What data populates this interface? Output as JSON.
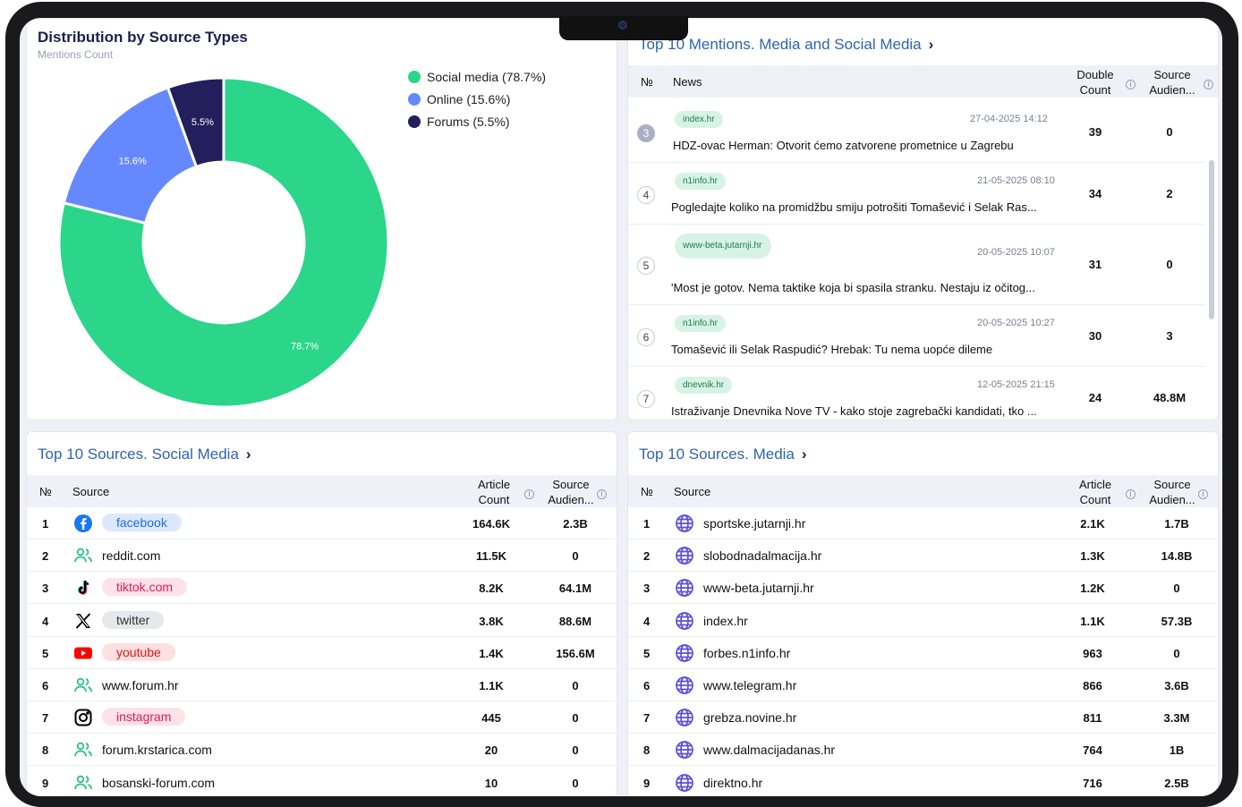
{
  "chart": {
    "title": "Distribution by Source Types",
    "subtitle": "Mentions Count",
    "legend": [
      {
        "label": "Social media (78.7%)",
        "color": "#2bd68a"
      },
      {
        "label": "Online (15.6%)",
        "color": "#6688ff"
      },
      {
        "label": "Forums (5.5%)",
        "color": "#231f5c"
      }
    ]
  },
  "chart_data": {
    "type": "pie",
    "title": "Distribution by Source Types",
    "subtitle": "Mentions Count",
    "categories": [
      "Social media",
      "Online",
      "Forums"
    ],
    "values": [
      78.7,
      15.6,
      5.5
    ],
    "labels": [
      "78.7%",
      "15.6%",
      "5.5%"
    ],
    "colors": [
      "#2bd68a",
      "#6688ff",
      "#231f5c"
    ],
    "donut": true,
    "legend": "top-right"
  },
  "mentions": {
    "title": "Top 10 Mentions. Media and Social Media",
    "headers": {
      "num": "№",
      "news": "News",
      "double_count": "Double Count",
      "audience": "Source Audien..."
    },
    "rows": [
      {
        "num": "3",
        "tag": "index.hr",
        "date": "27-04-2025 14:12",
        "text": "HDZ-ovac Herman: Otvorit ćemo zatvorene prometnice u Zagrebu",
        "count": "39",
        "audience": "0"
      },
      {
        "num": "4",
        "tag": "n1info.hr",
        "date": "21-05-2025 08:10",
        "text": "Pogledajte koliko na promidžbu smiju potrošiti Tomašević i Selak Ras...",
        "count": "34",
        "audience": "2"
      },
      {
        "num": "5",
        "tag": "www-beta.jutarnji.hr",
        "date": "20-05-2025 10:07",
        "text": "'Most je gotov. Nema taktike koja bi spasila stranku. Nestaju iz očitog...",
        "count": "31",
        "audience": "0"
      },
      {
        "num": "6",
        "tag": "n1info.hr",
        "date": "20-05-2025 10:27",
        "text": "Tomašević ili Selak Raspudić? Hrebak: Tu nema uopće dileme",
        "count": "30",
        "audience": "3"
      },
      {
        "num": "7",
        "tag": "dnevnik.hr",
        "date": "12-05-2025 21:15",
        "text": "Istraživanje Dnevnika Nove TV - kako stoje zagrebački kandidati, tko ...",
        "count": "24",
        "audience": "48.8M"
      }
    ]
  },
  "social": {
    "title": "Top 10 Sources. Social Media",
    "headers": {
      "num": "№",
      "source": "Source",
      "count": "Article Count",
      "audience": "Source Audien..."
    },
    "rows": [
      {
        "num": "1",
        "icon": "facebook-icon",
        "name": "facebook",
        "count": "164.6K",
        "audience": "2.3B"
      },
      {
        "num": "2",
        "icon": "users-icon",
        "name": "reddit.com",
        "count": "11.5K",
        "audience": "0"
      },
      {
        "num": "3",
        "icon": "tiktok-icon",
        "name": "tiktok.com",
        "count": "8.2K",
        "audience": "64.1M"
      },
      {
        "num": "4",
        "icon": "x-icon",
        "name": "twitter",
        "count": "3.8K",
        "audience": "88.6M"
      },
      {
        "num": "5",
        "icon": "youtube-icon",
        "name": "youtube",
        "count": "1.4K",
        "audience": "156.6M"
      },
      {
        "num": "6",
        "icon": "users-icon",
        "name": "www.forum.hr",
        "count": "1.1K",
        "audience": "0"
      },
      {
        "num": "7",
        "icon": "instagram-icon",
        "name": "instagram",
        "count": "445",
        "audience": "0"
      },
      {
        "num": "8",
        "icon": "users-icon",
        "name": "forum.krstarica.com",
        "count": "20",
        "audience": "0"
      },
      {
        "num": "9",
        "icon": "users-icon",
        "name": "bosanski-forum.com",
        "count": "10",
        "audience": "0"
      }
    ]
  },
  "media": {
    "title": "Top 10 Sources. Media",
    "headers": {
      "num": "№",
      "source": "Source",
      "count": "Article Count",
      "audience": "Source Audien..."
    },
    "rows": [
      {
        "num": "1",
        "name": "sportske.jutarnji.hr",
        "count": "2.1K",
        "audience": "1.7B"
      },
      {
        "num": "2",
        "name": "slobodnadalmacija.hr",
        "count": "1.3K",
        "audience": "14.8B"
      },
      {
        "num": "3",
        "name": "www-beta.jutarnji.hr",
        "count": "1.2K",
        "audience": "0"
      },
      {
        "num": "4",
        "name": "index.hr",
        "count": "1.1K",
        "audience": "57.3B"
      },
      {
        "num": "5",
        "name": "forbes.n1info.hr",
        "count": "963",
        "audience": "0"
      },
      {
        "num": "6",
        "name": "www.telegram.hr",
        "count": "866",
        "audience": "3.6B"
      },
      {
        "num": "7",
        "name": "grebza.novine.hr",
        "count": "811",
        "audience": "3.3M"
      },
      {
        "num": "8",
        "name": "www.dalmacijadanas.hr",
        "count": "764",
        "audience": "1B"
      },
      {
        "num": "9",
        "name": "direktno.hr",
        "count": "716",
        "audience": "2.5B"
      }
    ]
  }
}
